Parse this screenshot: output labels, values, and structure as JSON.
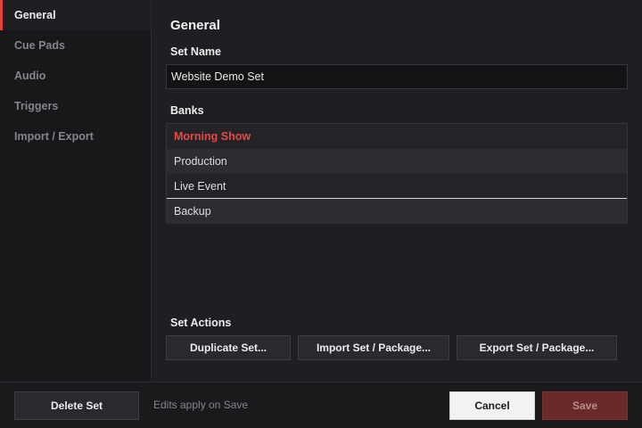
{
  "sidebar": {
    "items": [
      {
        "label": "General"
      },
      {
        "label": "Cue Pads"
      },
      {
        "label": "Audio"
      },
      {
        "label": "Triggers"
      },
      {
        "label": "Import / Export"
      }
    ],
    "active_index": 0
  },
  "main": {
    "title": "General",
    "set_name_label": "Set Name",
    "set_name_value": "Website Demo Set",
    "banks_label": "Banks",
    "banks": [
      {
        "name": "Morning Show",
        "selected": true
      },
      {
        "name": "Production",
        "selected": false
      },
      {
        "name": "Live Event",
        "selected": false
      },
      {
        "name": "Backup",
        "selected": false
      }
    ],
    "set_actions_label": "Set Actions",
    "actions": {
      "duplicate": "Duplicate Set...",
      "import": "Import Set / Package...",
      "export": "Export Set / Package..."
    }
  },
  "footer": {
    "delete_label": "Delete Set",
    "note": "Edits apply on Save",
    "cancel_label": "Cancel",
    "save_label": "Save"
  },
  "colors": {
    "accent": "#e0433c",
    "save_disabled": "#6b2a2a"
  }
}
